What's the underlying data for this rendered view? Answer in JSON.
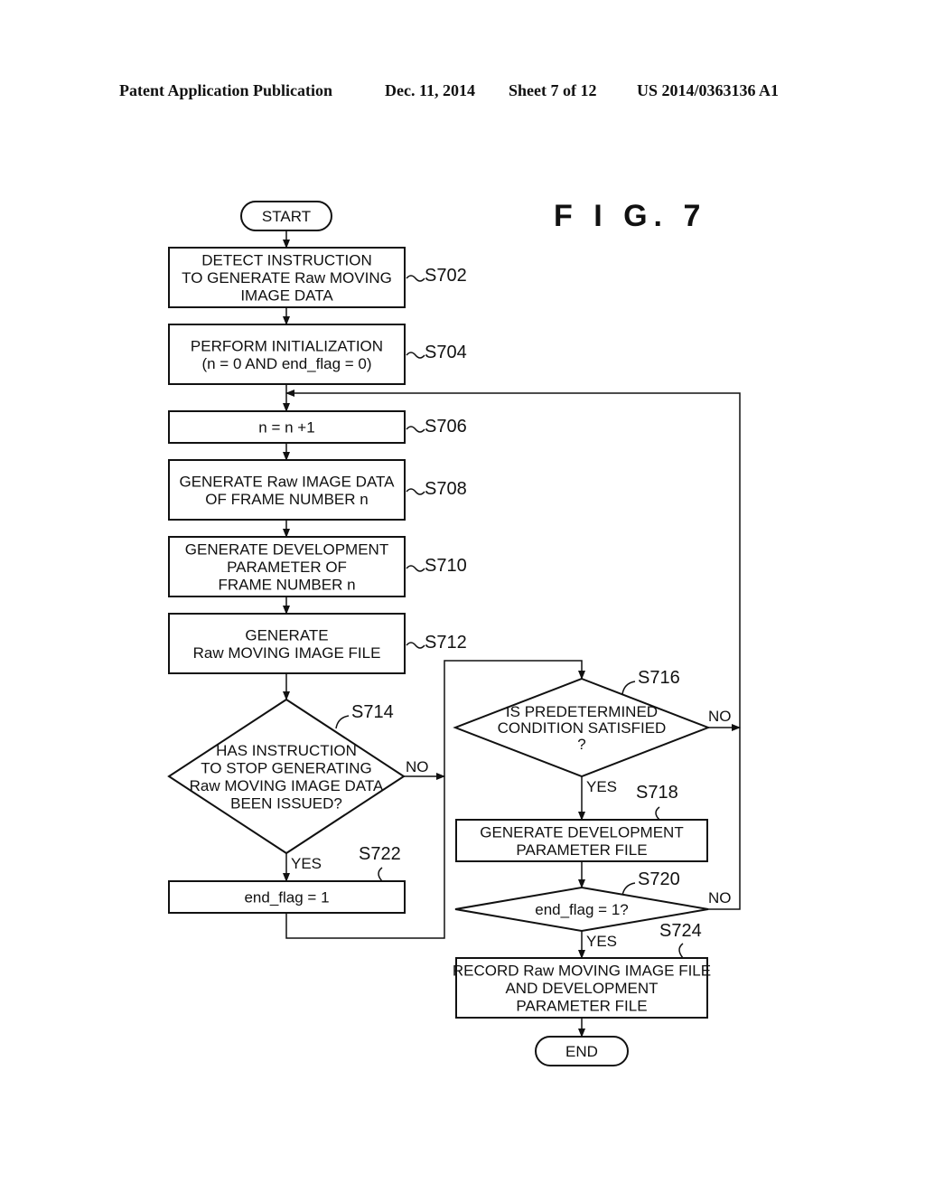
{
  "header": {
    "publication": "Patent Application Publication",
    "date": "Dec. 11, 2014",
    "sheet": "Sheet 7 of 12",
    "number": "US 2014/0363136 A1"
  },
  "figure_label": "F I G. 7",
  "nodes": {
    "start": {
      "lines": [
        "START"
      ]
    },
    "s702": {
      "step": "S702",
      "lines": [
        "DETECT INSTRUCTION",
        "TO GENERATE Raw MOVING",
        "IMAGE DATA"
      ]
    },
    "s704": {
      "step": "S704",
      "lines": [
        "PERFORM INITIALIZATION",
        "(n = 0 AND end_flag = 0)"
      ]
    },
    "s706": {
      "step": "S706",
      "lines": [
        "n = n +1"
      ]
    },
    "s708": {
      "step": "S708",
      "lines": [
        "GENERATE Raw IMAGE DATA",
        "OF FRAME NUMBER n"
      ]
    },
    "s710": {
      "step": "S710",
      "lines": [
        "GENERATE DEVELOPMENT",
        "PARAMETER OF",
        "FRAME NUMBER n"
      ]
    },
    "s712": {
      "step": "S712",
      "lines": [
        "GENERATE",
        "Raw MOVING IMAGE FILE"
      ]
    },
    "s714": {
      "step": "S714",
      "lines": [
        "HAS INSTRUCTION",
        "TO STOP GENERATING",
        "Raw MOVING IMAGE DATA",
        "BEEN ISSUED?"
      ]
    },
    "s716": {
      "step": "S716",
      "lines": [
        "IS PREDETERMINED",
        "CONDITION SATISFIED",
        "?"
      ]
    },
    "s718": {
      "step": "S718",
      "lines": [
        "GENERATE DEVELOPMENT",
        "PARAMETER FILE"
      ]
    },
    "s720": {
      "step": "S720",
      "lines": [
        "end_flag = 1?"
      ]
    },
    "s722": {
      "step": "S722",
      "lines": [
        "end_flag = 1"
      ]
    },
    "s724": {
      "step": "S724",
      "lines": [
        "RECORD Raw MOVING IMAGE FILE",
        "AND DEVELOPMENT",
        "PARAMETER FILE"
      ]
    },
    "end": {
      "lines": [
        "END"
      ]
    }
  },
  "branches": {
    "s714_no": "NO",
    "s714_yes": "YES",
    "s716_no": "NO",
    "s716_yes": "YES",
    "s720_no": "NO",
    "s720_yes": "YES"
  }
}
